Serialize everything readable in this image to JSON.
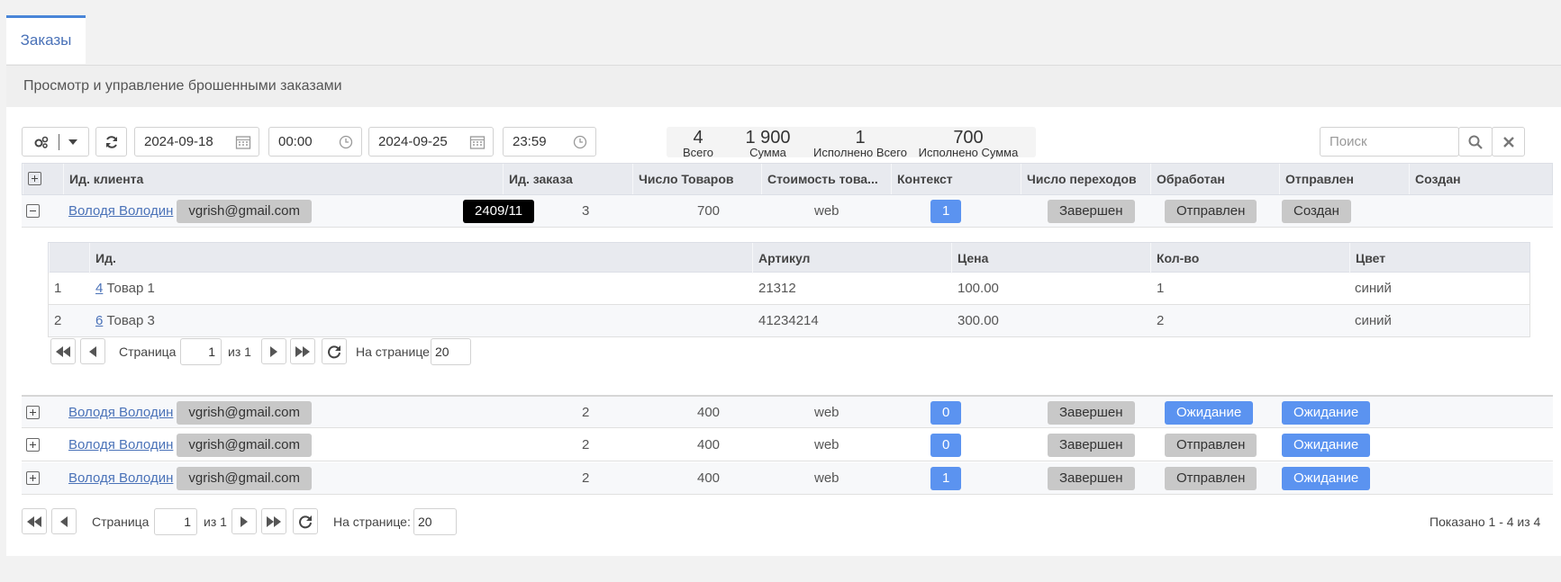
{
  "tab": {
    "label": "Заказы"
  },
  "panel": {
    "title": "Просмотр и управление брошенными заказами"
  },
  "toolbar": {
    "date_from": "2024-09-18",
    "time_from": "00:00",
    "date_to": "2024-09-25",
    "time_to": "23:59",
    "search_placeholder": "Поиск"
  },
  "stats": [
    {
      "value": "4",
      "label": "Всего"
    },
    {
      "value": "1 900",
      "label": "Сумма"
    },
    {
      "value": "1",
      "label": "Исполнено Всего"
    },
    {
      "value": "700",
      "label": "Исполнено Сумма"
    }
  ],
  "grid": {
    "columns": [
      "Ид. клиента",
      "Ид. заказа",
      "Число Товаров",
      "Стоимость това...",
      "Контекст",
      "Число переходов",
      "Обработан",
      "Отправлен",
      "Создан"
    ],
    "rows": [
      {
        "client": "Володя Володин",
        "email": "vgrish@gmail.com",
        "order_id": "2409/11",
        "items": "3",
        "cost": "700",
        "context": "web",
        "visits": "1",
        "processed": "Завершен",
        "sent": "Отправлен",
        "created": "Создан",
        "expanded": true
      },
      {
        "client": "Володя Володин",
        "email": "vgrish@gmail.com",
        "order_id": "",
        "items": "2",
        "cost": "400",
        "context": "web",
        "visits": "0",
        "processed": "Завершен",
        "sent": "Ожидание",
        "created": "Ожидание"
      },
      {
        "client": "Володя Володин",
        "email": "vgrish@gmail.com",
        "order_id": "",
        "items": "2",
        "cost": "400",
        "context": "web",
        "visits": "0",
        "processed": "Завершен",
        "sent": "Отправлен",
        "created": "Ожидание"
      },
      {
        "client": "Володя Володин",
        "email": "vgrish@gmail.com",
        "order_id": "",
        "items": "2",
        "cost": "400",
        "context": "web",
        "visits": "1",
        "processed": "Завершен",
        "sent": "Отправлен",
        "created": "Ожидание"
      }
    ]
  },
  "subgrid": {
    "columns": [
      "Ид.",
      "Артикул",
      "Цена",
      "Кол-во",
      "Цвет"
    ],
    "rows": [
      {
        "n": "1",
        "id": "4",
        "name": "Товар 1",
        "article": "21312",
        "price": "100.00",
        "qty": "1",
        "color": "синий"
      },
      {
        "n": "2",
        "id": "6",
        "name": "Товар 3",
        "article": "41234214",
        "price": "300.00",
        "qty": "2",
        "color": "синий"
      }
    ]
  },
  "pager": {
    "page_label": "Страница",
    "page_value": "1",
    "of_label": "из 1",
    "per_page_label": "На странице:",
    "per_page_value": "20",
    "summary": "Показано 1 - 4 из 4"
  }
}
